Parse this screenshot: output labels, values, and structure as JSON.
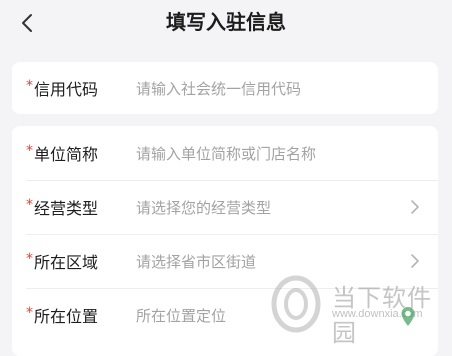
{
  "header": {
    "title": "填写入驻信息",
    "back_icon": "chevron-left-icon"
  },
  "form": {
    "required_mark": "*",
    "credit_code": {
      "label": "信用代码",
      "placeholder": "请输入社会统一信用代码"
    },
    "unit_name": {
      "label": "单位简称",
      "placeholder": "请输入单位简称或门店名称"
    },
    "business_type": {
      "label": "经营类型",
      "placeholder": "请选择您的经营类型",
      "icon": "chevron-right-icon"
    },
    "region": {
      "label": "所在区域",
      "placeholder": "请选择省市区街道",
      "icon": "chevron-right-icon"
    },
    "location": {
      "label": "所在位置",
      "placeholder": "所在位置定位"
    }
  },
  "watermark": {
    "text": "当下软件园",
    "url": "www.downxia.com",
    "logo_icon": "downxia-logo-icon",
    "pin_icon": "map-pin-icon"
  },
  "colors": {
    "background": "#f4f4f6",
    "card": "#ffffff",
    "required": "#e2463a",
    "placeholder": "#a3a3a3",
    "label": "#1e1e1e"
  }
}
